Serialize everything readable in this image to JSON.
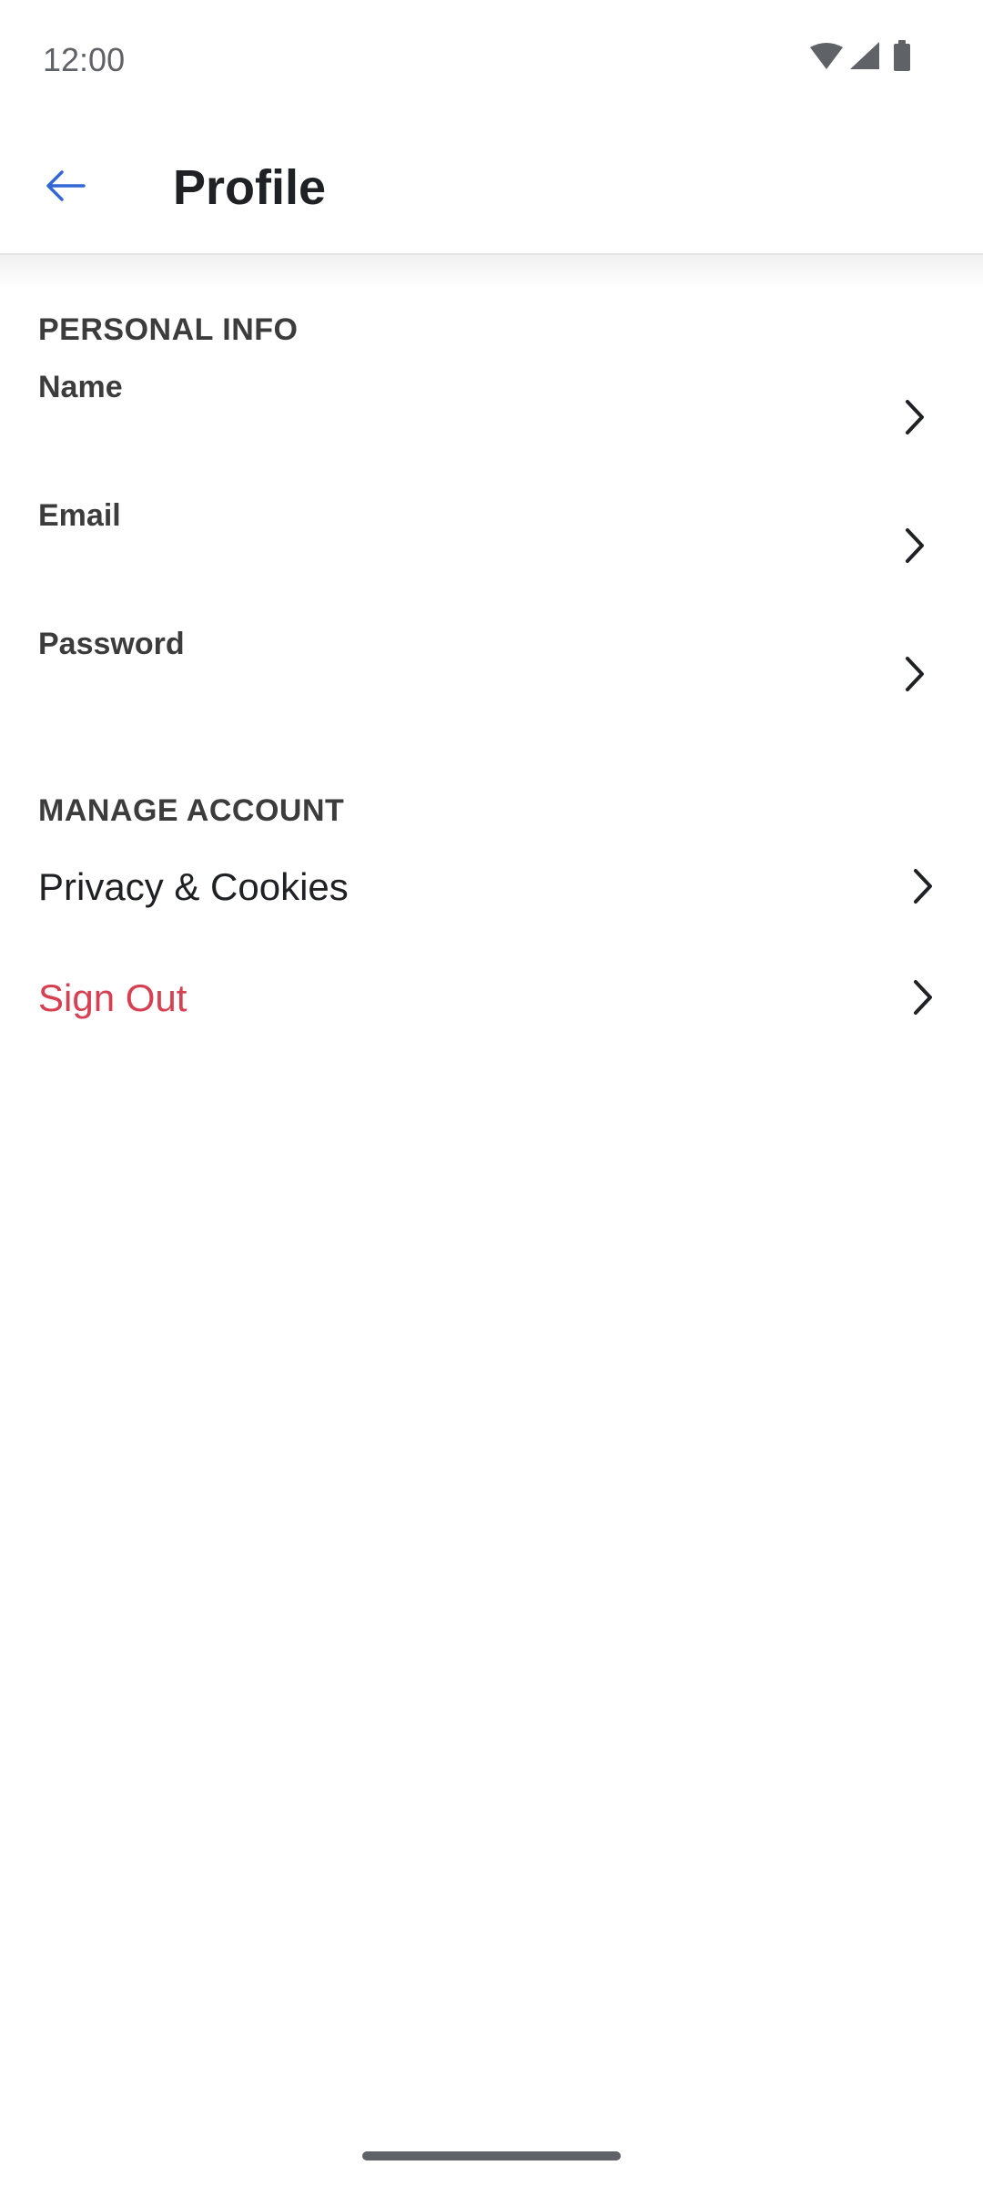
{
  "status_bar": {
    "time": "12:00",
    "icons": [
      "wifi-icon",
      "cellular-signal-icon",
      "battery-icon"
    ]
  },
  "app_bar": {
    "back_icon": "arrow-left-icon",
    "title": "Profile"
  },
  "personal_info": {
    "header": "PERSONAL INFO",
    "items": [
      {
        "label": "Name",
        "icon": "chevron-right-icon"
      },
      {
        "label": "Email",
        "icon": "chevron-right-icon"
      },
      {
        "label": "Password",
        "icon": "chevron-right-icon"
      }
    ]
  },
  "manage_account": {
    "header": "MANAGE ACCOUNT",
    "items": [
      {
        "label": "Privacy & Cookies",
        "icon": "chevron-right-icon"
      },
      {
        "label": "Sign Out",
        "icon": "chevron-right-icon"
      }
    ]
  },
  "colors": {
    "accent": "#3367d6",
    "danger": "#d64050",
    "text": "#202124",
    "section_text": "#3c3c3c"
  }
}
